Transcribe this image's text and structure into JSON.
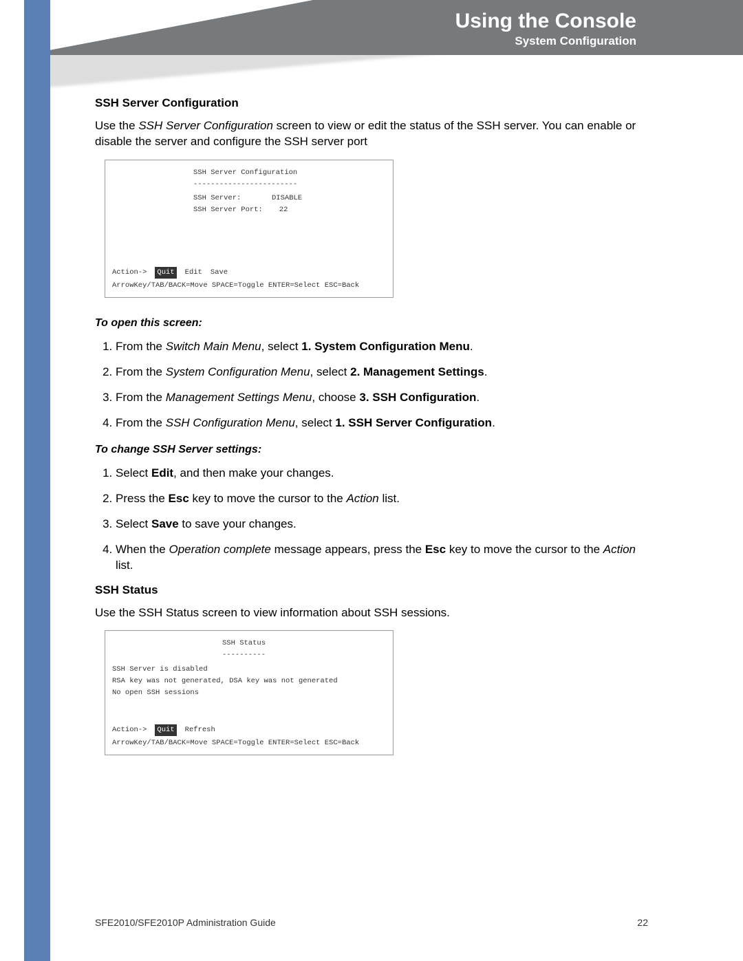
{
  "header": {
    "title": "Using the Console",
    "subtitle": "System Configuration"
  },
  "section1": {
    "heading": "SSH Server Configuration",
    "intro_a": "Use the ",
    "intro_i": "SSH Server Configuration",
    "intro_b": " screen to view or edit the status of the SSH server. You can enable or disable the server and configure the SSH server port"
  },
  "console1": {
    "title": "SSH Server Configuration",
    "divider": "------------------------",
    "row1_label": "SSH Server:",
    "row1_value": "DISABLE",
    "row2_label": "SSH Server Port:",
    "row2_value": "22",
    "action_prefix": "Action->",
    "action_selected": "Quit",
    "action_2": "Edit",
    "action_3": "Save",
    "hint": "ArrowKey/TAB/BACK=Move  SPACE=Toggle  ENTER=Select  ESC=Back"
  },
  "open_screen": {
    "heading": "To open this screen:",
    "steps": [
      {
        "pre": "From the ",
        "i": "Switch Main Menu",
        "mid": ", select ",
        "b": "1. System Configuration Menu",
        "post": "."
      },
      {
        "pre": "From the ",
        "i": "System Configuration Menu",
        "mid": ", select ",
        "b": "2. Management Settings",
        "post": "."
      },
      {
        "pre": "From the ",
        "i": "Management Settings Menu",
        "mid": ", choose ",
        "b": "3. SSH Configuration",
        "post": "."
      },
      {
        "pre": "From the ",
        "i": "SSH Configuration Menu",
        "mid": ", select ",
        "b": "1. SSH Server Configuration",
        "post": "."
      }
    ]
  },
  "change_settings": {
    "heading": "To change SSH Server settings:",
    "step1_a": "Select ",
    "step1_b": "Edit",
    "step1_c": ", and then make your changes.",
    "step2_a": "Press the ",
    "step2_b": "Esc",
    "step2_c": " key to move the cursor to the ",
    "step2_d": "Action",
    "step2_e": " list.",
    "step3_a": "Select ",
    "step3_b": "Save",
    "step3_c": " to save your changes.",
    "step4_a": "When the ",
    "step4_b": "Operation complete",
    "step4_c": " message appears, press the ",
    "step4_d": "Esc",
    "step4_e": " key to move the cursor to the ",
    "step4_f": "Action",
    "step4_g": " list."
  },
  "section2": {
    "heading": "SSH Status",
    "intro": "Use the SSH Status screen to view information about SSH sessions."
  },
  "console2": {
    "title": "SSH Status",
    "divider": "----------",
    "line1": "SSH Server is disabled",
    "line2": "RSA key was not generated, DSA key was not generated",
    "line3": "No open SSH sessions",
    "action_prefix": "Action->",
    "action_selected": "Quit",
    "action_2": "Refresh",
    "hint": "ArrowKey/TAB/BACK=Move  SPACE=Toggle  ENTER=Select  ESC=Back"
  },
  "footer": {
    "guide": "SFE2010/SFE2010P Administration Guide",
    "page": "22"
  }
}
